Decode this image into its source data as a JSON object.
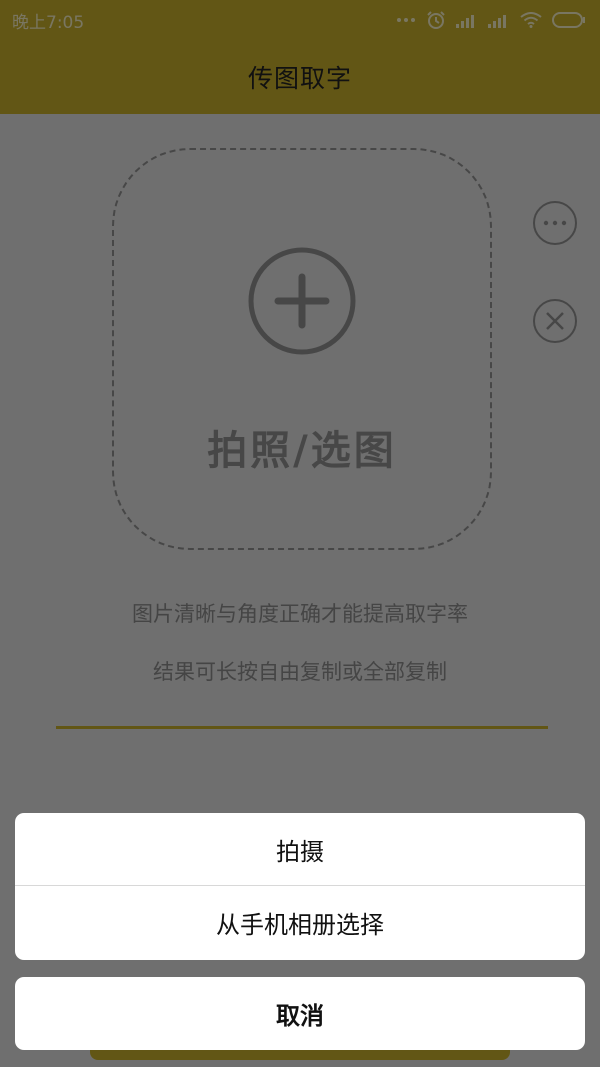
{
  "status_bar": {
    "time": "晚上7:05",
    "icons": [
      "more-dots-icon",
      "alarm-icon",
      "signal-icon",
      "signal-icon",
      "wifi-icon",
      "battery-icon"
    ]
  },
  "header": {
    "title": "传图取字"
  },
  "upload": {
    "label": "拍照/选图",
    "icon": "plus-circle-icon"
  },
  "side_actions": [
    {
      "icon": "more-icon"
    },
    {
      "icon": "close-icon"
    }
  ],
  "hints": [
    "图片清晰与角度正确才能提高取字率",
    "结果可长按自由复制或全部复制"
  ],
  "action_sheet": {
    "options": [
      "拍摄",
      "从手机相册选择"
    ],
    "cancel": "取消"
  },
  "colors": {
    "accent": "#c5ad2a",
    "background": "#dedede",
    "muted": "#8e8e8e",
    "overlay": "rgba(0,0,0,0.5)"
  }
}
